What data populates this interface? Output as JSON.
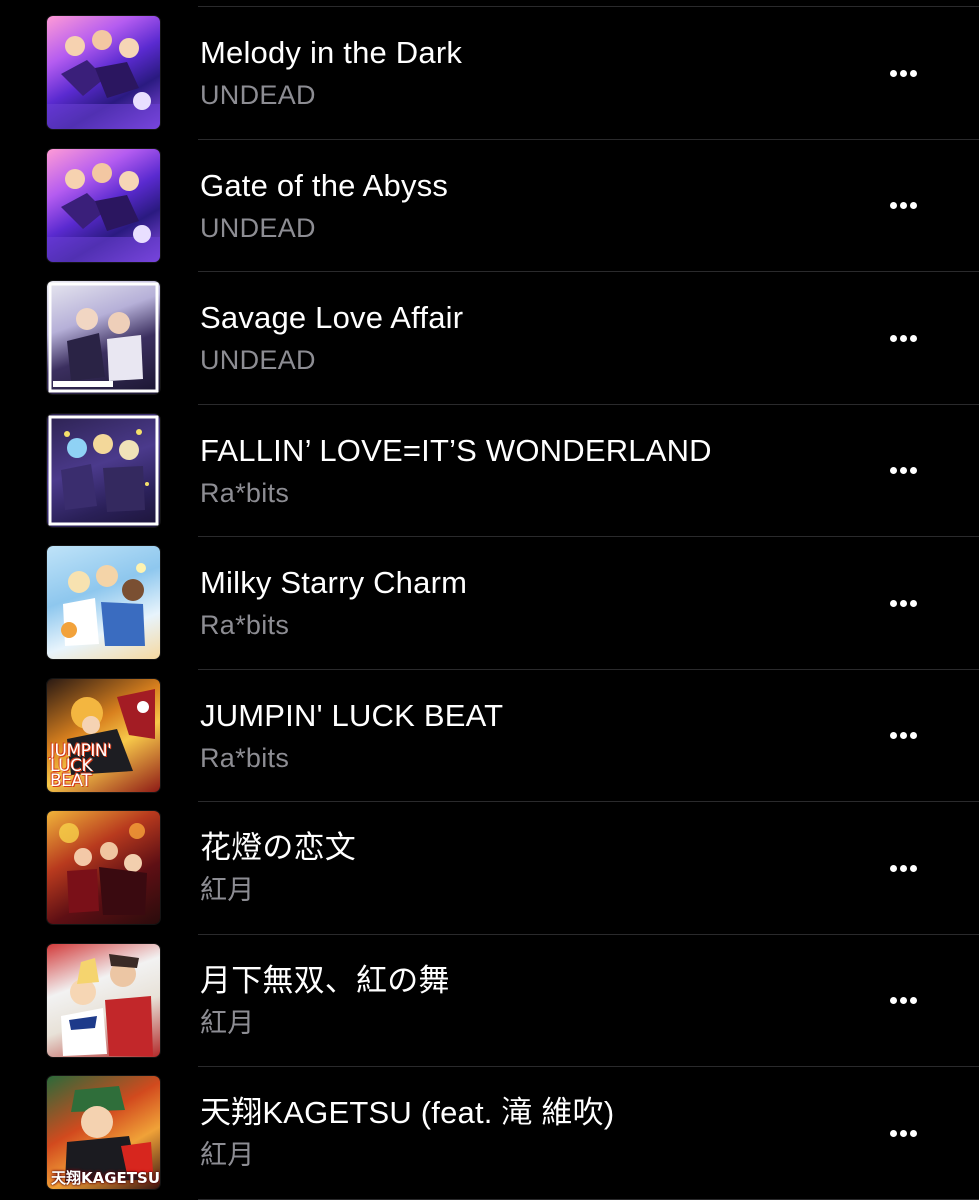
{
  "songs": [
    {
      "title": "Melody in the Dark",
      "artist": "UNDEAD",
      "art_text": ""
    },
    {
      "title": "Gate of the Abyss",
      "artist": "UNDEAD",
      "art_text": ""
    },
    {
      "title": "Savage Love Affair",
      "artist": "UNDEAD",
      "art_text": ""
    },
    {
      "title": "FALLIN’ LOVE=IT’S WONDERLAND",
      "artist": "Ra*bits",
      "art_text": ""
    },
    {
      "title": "Milky Starry Charm",
      "artist": "Ra*bits",
      "art_text": ""
    },
    {
      "title": "JUMPIN' LUCK BEAT",
      "artist": "Ra*bits",
      "art_text": "JUMPIN' LUCK BEAT"
    },
    {
      "title": "花燈の恋文",
      "artist": "紅月",
      "art_text": ""
    },
    {
      "title": "月下無双、紅の舞",
      "artist": "紅月",
      "art_text": ""
    },
    {
      "title": "天翔KAGETSU (feat. 滝 維吹)",
      "artist": "紅月",
      "art_text": "天翔KAGETSU"
    }
  ],
  "more_icon": "ellipsis-icon",
  "colors": {
    "background": "#000000",
    "title": "#ffffff",
    "artist": "#8d8d93",
    "divider": "#2a2a2c"
  }
}
